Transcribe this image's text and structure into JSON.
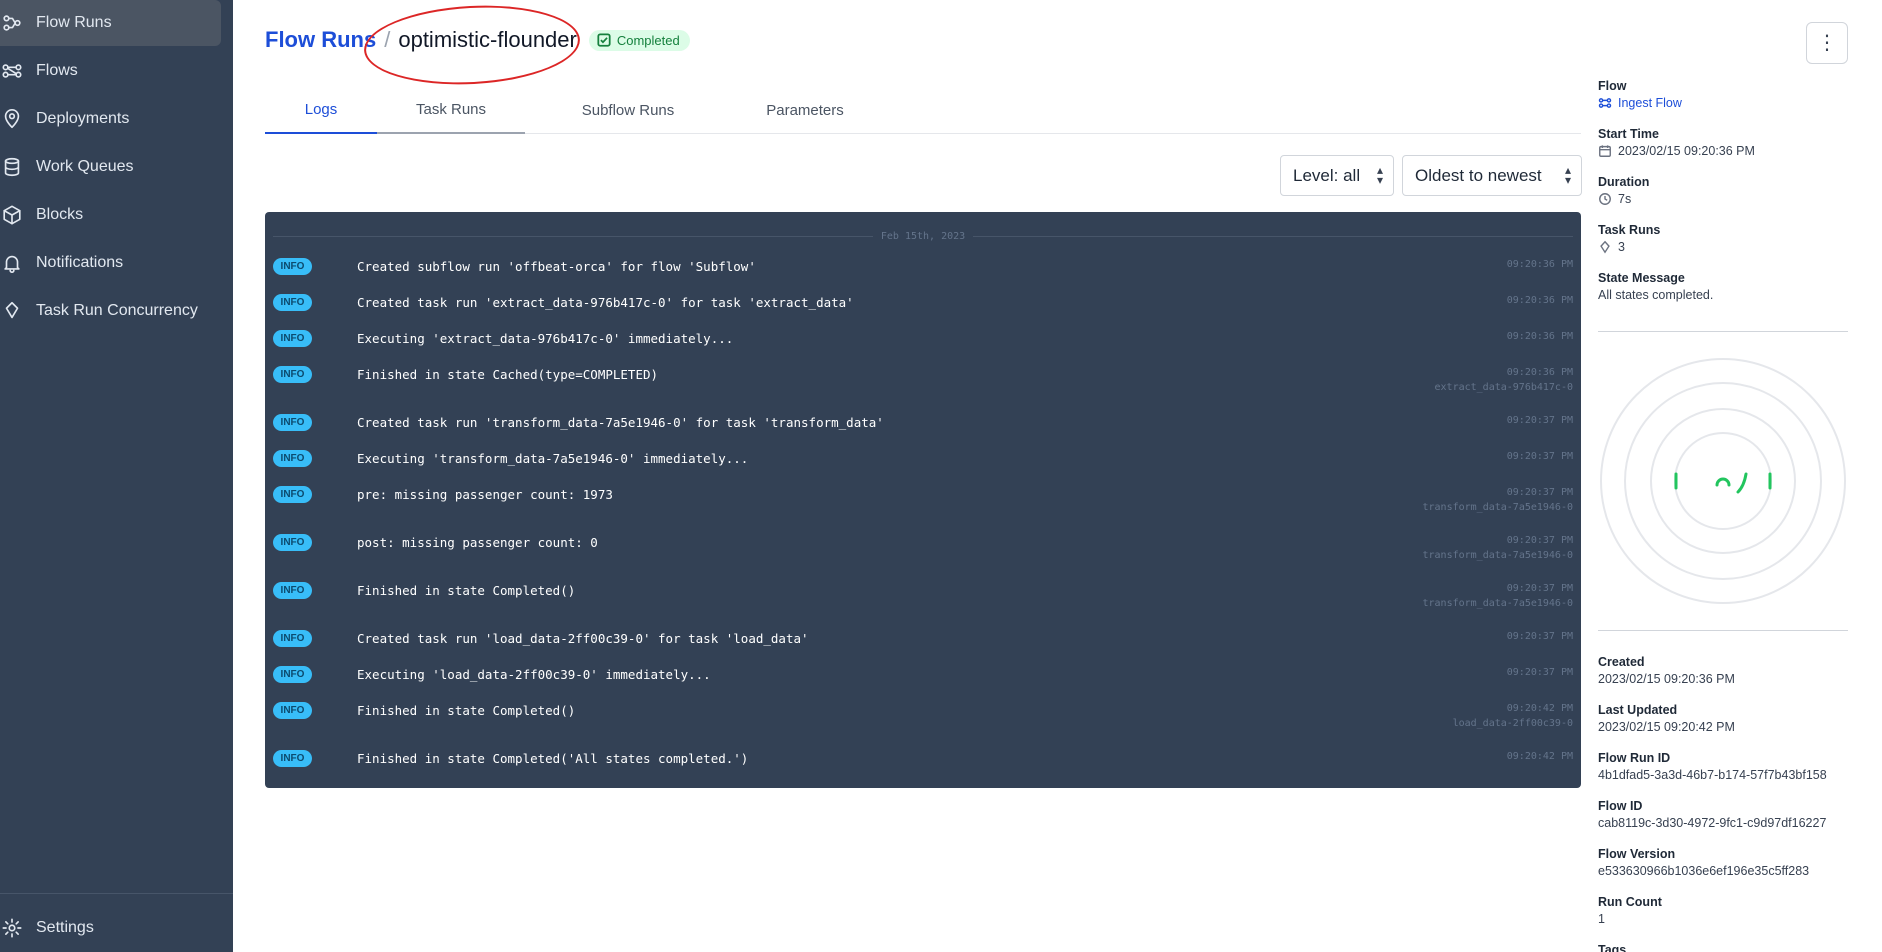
{
  "sidebar": {
    "items": [
      {
        "label": "Flow Runs",
        "icon": "flow-runs-icon"
      },
      {
        "label": "Flows",
        "icon": "flows-icon"
      },
      {
        "label": "Deployments",
        "icon": "deployments-icon"
      },
      {
        "label": "Work Queues",
        "icon": "work-queues-icon"
      },
      {
        "label": "Blocks",
        "icon": "blocks-icon"
      },
      {
        "label": "Notifications",
        "icon": "bell-icon"
      },
      {
        "label": "Task Run Concurrency",
        "icon": "concurrency-icon"
      }
    ],
    "settings_label": "Settings"
  },
  "header": {
    "breadcrumb_root": "Flow Runs",
    "separator": "/",
    "run_name": "optimistic-flounder",
    "status": "Completed",
    "menu_icon": "⋮"
  },
  "tabs": [
    {
      "label": "Logs"
    },
    {
      "label": "Task Runs"
    },
    {
      "label": "Subflow Runs"
    },
    {
      "label": "Parameters"
    }
  ],
  "filters": {
    "level": "Level: all",
    "order": "Oldest to newest"
  },
  "logs": {
    "date": "Feb 15th, 2023",
    "entries": [
      {
        "level": "INFO",
        "message": "Created subflow run 'offbeat-orca' for flow 'Subflow'",
        "time": "09:20:36 PM",
        "task": ""
      },
      {
        "level": "INFO",
        "message": "Created task run 'extract_data-976b417c-0' for task 'extract_data'",
        "time": "09:20:36 PM",
        "task": ""
      },
      {
        "level": "INFO",
        "message": "Executing 'extract_data-976b417c-0' immediately...",
        "time": "09:20:36 PM",
        "task": ""
      },
      {
        "level": "INFO",
        "message": "Finished in state Cached(type=COMPLETED)",
        "time": "09:20:36 PM",
        "task": "extract_data-976b417c-0"
      },
      {
        "level": "INFO",
        "message": "Created task run 'transform_data-7a5e1946-0' for task 'transform_data'",
        "time": "09:20:37 PM",
        "task": ""
      },
      {
        "level": "INFO",
        "message": "Executing 'transform_data-7a5e1946-0' immediately...",
        "time": "09:20:37 PM",
        "task": ""
      },
      {
        "level": "INFO",
        "message": "pre: missing passenger count: 1973",
        "time": "09:20:37 PM",
        "task": "transform_data-7a5e1946-0"
      },
      {
        "level": "INFO",
        "message": "post: missing passenger count: 0",
        "time": "09:20:37 PM",
        "task": "transform_data-7a5e1946-0"
      },
      {
        "level": "INFO",
        "message": "Finished in state Completed()",
        "time": "09:20:37 PM",
        "task": "transform_data-7a5e1946-0"
      },
      {
        "level": "INFO",
        "message": "Created task run 'load_data-2ff00c39-0' for task 'load_data'",
        "time": "09:20:37 PM",
        "task": ""
      },
      {
        "level": "INFO",
        "message": "Executing 'load_data-2ff00c39-0' immediately...",
        "time": "09:20:37 PM",
        "task": ""
      },
      {
        "level": "INFO",
        "message": "Finished in state Completed()",
        "time": "09:20:42 PM",
        "task": "load_data-2ff00c39-0"
      },
      {
        "level": "INFO",
        "message": "Finished in state Completed('All states completed.')",
        "time": "09:20:42 PM",
        "task": ""
      }
    ]
  },
  "details": {
    "flow_label": "Flow",
    "flow_value": "Ingest Flow",
    "start_label": "Start Time",
    "start_value": "2023/02/15 09:20:36 PM",
    "duration_label": "Duration",
    "duration_value": "7s",
    "task_runs_label": "Task Runs",
    "task_runs_value": "3",
    "state_message_label": "State Message",
    "state_message_value": "All states completed.",
    "created_label": "Created",
    "created_value": "2023/02/15 09:20:36 PM",
    "updated_label": "Last Updated",
    "updated_value": "2023/02/15 09:20:42 PM",
    "run_id_label": "Flow Run ID",
    "run_id_value": "4b1dfad5-3a3d-46b7-b174-57f7b43bf158",
    "flow_id_label": "Flow ID",
    "flow_id_value": "cab8119c-3d30-4972-9fc1-c9d97df16227",
    "version_label": "Flow Version",
    "version_value": "e533630966b1036e6ef196e35c5ff283",
    "run_count_label": "Run Count",
    "run_count_value": "1",
    "tags_label": "Tags"
  },
  "colors": {
    "sidebar_bg": "#334155",
    "accent": "#1d4ed8",
    "completed": "#15803d",
    "log_bg": "#334155",
    "info_badge": "#38bdf8"
  }
}
